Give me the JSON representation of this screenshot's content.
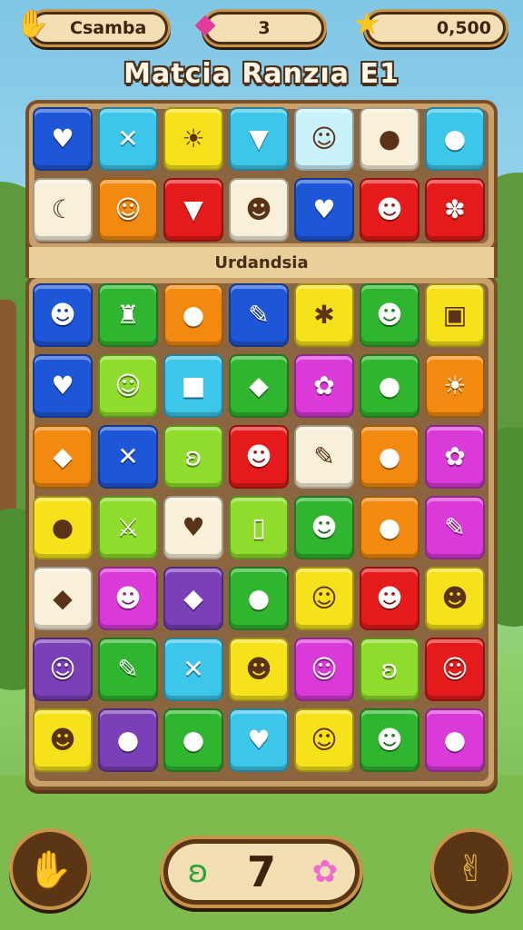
{
  "hud": {
    "left_label": "Csamba",
    "left_icon": "paw-icon",
    "gems_value": "3",
    "gems_icon": "gem-icon",
    "score_value": "0,500",
    "score_icon": "star-icon"
  },
  "title": "Matcia Ranzıa E1",
  "section_label": "Urdandsia",
  "colors": {
    "blue": "#1e56d8",
    "cyan": "#3cc6ea",
    "yellow": "#f6e21a",
    "red": "#e51a1a",
    "orange": "#f28a12",
    "green": "#2fb52f",
    "lime": "#8fdc2c",
    "cream": "#f8f0d8",
    "purple": "#7b3fb8",
    "magenta": "#d93ad8",
    "light": "#c9f2fb",
    "board_frame": "#7a4f27"
  },
  "top_grid": [
    [
      {
        "c": "blue",
        "i": "heart-icon",
        "g": "♥"
      },
      {
        "c": "cyan",
        "i": "crossed-swords-icon",
        "g": "✕"
      },
      {
        "c": "yellow",
        "i": "sun-face-icon",
        "g": "☀"
      },
      {
        "c": "cyan",
        "i": "bucket-icon",
        "g": "▼"
      },
      {
        "c": "light",
        "i": "ghost-icon",
        "g": "☺"
      },
      {
        "c": "cream",
        "i": "peanut-icon",
        "g": "●"
      },
      {
        "c": "cyan",
        "i": "green-ball-icon",
        "g": "●"
      }
    ],
    [
      {
        "c": "cream",
        "i": "moon-icon",
        "g": "☾"
      },
      {
        "c": "orange",
        "i": "cat-face-icon",
        "g": "☺"
      },
      {
        "c": "red",
        "i": "cup-icon",
        "g": "▼"
      },
      {
        "c": "cream",
        "i": "orange-blob-icon",
        "g": "☻"
      },
      {
        "c": "blue",
        "i": "heart-icon",
        "g": "♥"
      },
      {
        "c": "red",
        "i": "smiley-icon",
        "g": "☻"
      },
      {
        "c": "red",
        "i": "puzzle-icon",
        "g": "✽"
      }
    ]
  ],
  "main_grid": [
    [
      {
        "c": "blue",
        "i": "smiley-icon",
        "g": "☻"
      },
      {
        "c": "green",
        "i": "potion-icon",
        "g": "♜"
      },
      {
        "c": "orange",
        "i": "leaf-icon",
        "g": "●"
      },
      {
        "c": "blue",
        "i": "feather-icon",
        "g": "✎"
      },
      {
        "c": "yellow",
        "i": "star-burst-icon",
        "g": "✱"
      },
      {
        "c": "green",
        "i": "blue-smiley-icon",
        "g": "☻"
      },
      {
        "c": "yellow",
        "i": "box-icon",
        "g": "▣"
      }
    ],
    [
      {
        "c": "blue",
        "i": "heart-icon",
        "g": "♥"
      },
      {
        "c": "lime",
        "i": "cat-face-icon",
        "g": "☺"
      },
      {
        "c": "cyan",
        "i": "ice-cube-icon",
        "g": "■"
      },
      {
        "c": "green",
        "i": "shell-icon",
        "g": "◆"
      },
      {
        "c": "magenta",
        "i": "rose-icon",
        "g": "✿"
      },
      {
        "c": "green",
        "i": "radish-icon",
        "g": "●"
      },
      {
        "c": "orange",
        "i": "sun-face-icon",
        "g": "☀"
      }
    ],
    [
      {
        "c": "orange",
        "i": "leaf-icon",
        "g": "◆"
      },
      {
        "c": "blue",
        "i": "crossed-swords-icon",
        "g": "✕"
      },
      {
        "c": "lime",
        "i": "swirl-icon",
        "g": "ʚ"
      },
      {
        "c": "red",
        "i": "smiley-icon",
        "g": "☻"
      },
      {
        "c": "cream",
        "i": "feather-icon",
        "g": "✎"
      },
      {
        "c": "orange",
        "i": "leaf-icon",
        "g": "●"
      },
      {
        "c": "magenta",
        "i": "flower-icon",
        "g": "✿"
      }
    ],
    [
      {
        "c": "yellow",
        "i": "acorn-icon",
        "g": "●"
      },
      {
        "c": "lime",
        "i": "sword-icon",
        "g": "⚔"
      },
      {
        "c": "cream",
        "i": "heart-icon",
        "g": "♥"
      },
      {
        "c": "lime",
        "i": "jar-icon",
        "g": "▯"
      },
      {
        "c": "green",
        "i": "blob-icon",
        "g": "☻"
      },
      {
        "c": "orange",
        "i": "eggplant-icon",
        "g": "●"
      },
      {
        "c": "magenta",
        "i": "pencil-icon",
        "g": "✎"
      }
    ],
    [
      {
        "c": "cream",
        "i": "leaf-icon",
        "g": "◆"
      },
      {
        "c": "magenta",
        "i": "potion-icon",
        "g": "☻"
      },
      {
        "c": "purple",
        "i": "leaf-icon",
        "g": "◆"
      },
      {
        "c": "green",
        "i": "leaf-icon",
        "g": "●"
      },
      {
        "c": "yellow",
        "i": "pig-face-icon",
        "g": "☺"
      },
      {
        "c": "red",
        "i": "blue-smiley-icon",
        "g": "☻"
      },
      {
        "c": "yellow",
        "i": "blue-smiley-icon",
        "g": "☻"
      }
    ],
    [
      {
        "c": "purple",
        "i": "ghost-icon",
        "g": "☺"
      },
      {
        "c": "green",
        "i": "feather-icon",
        "g": "✎"
      },
      {
        "c": "cyan",
        "i": "crossed-swords-icon",
        "g": "✕"
      },
      {
        "c": "yellow",
        "i": "robot-icon",
        "g": "☻"
      },
      {
        "c": "magenta",
        "i": "bear-face-icon",
        "g": "☺"
      },
      {
        "c": "lime",
        "i": "swirl-icon",
        "g": "ʚ"
      },
      {
        "c": "red",
        "i": "cat-face-icon",
        "g": "☺"
      }
    ],
    [
      {
        "c": "yellow",
        "i": "blob-icon",
        "g": "☻"
      },
      {
        "c": "purple",
        "i": "eggplant-icon",
        "g": "●"
      },
      {
        "c": "green",
        "i": "leaf-icon",
        "g": "●"
      },
      {
        "c": "cyan",
        "i": "strawberry-icon",
        "g": "♥"
      },
      {
        "c": "yellow",
        "i": "cat-face-icon",
        "g": "☺"
      },
      {
        "c": "green",
        "i": "blob-icon",
        "g": "☻"
      },
      {
        "c": "magenta",
        "i": "berry-icon",
        "g": "●"
      }
    ]
  ],
  "bottom": {
    "left_button_icon": "paw-icon",
    "right_button_icon": "claw-icon",
    "moves_value": "7",
    "moves_left_icon": "swirl-icon",
    "moves_right_icon": "flower-icon"
  }
}
